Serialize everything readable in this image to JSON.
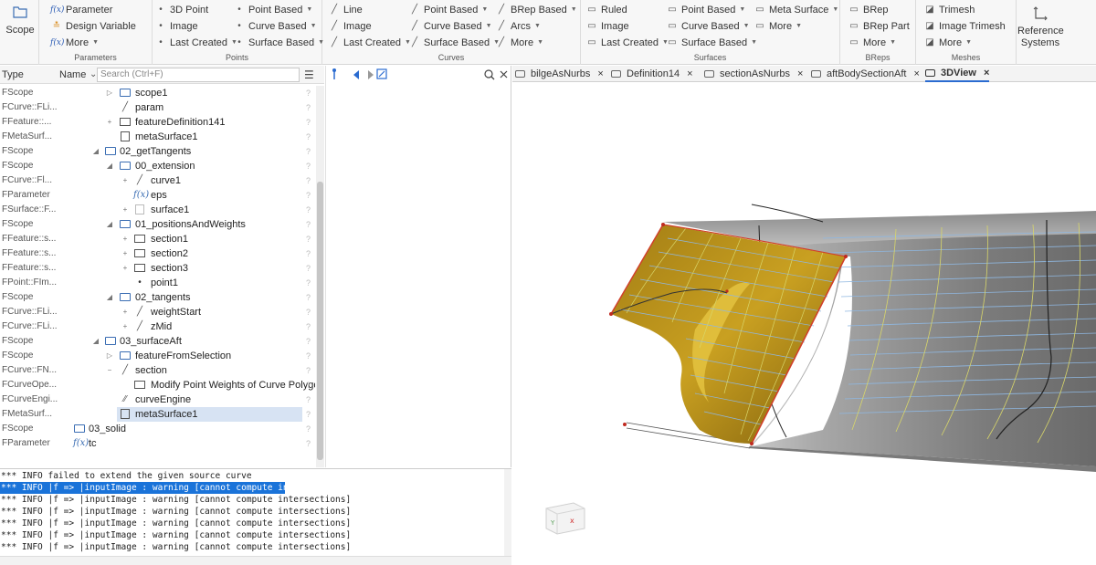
{
  "ribbon": {
    "scope_label": "Scope",
    "parameters": {
      "label": "Parameters",
      "items": [
        "Parameter",
        "Design Variable",
        "More"
      ]
    },
    "points": {
      "label": "Points",
      "col1": [
        "3D Point",
        "Image",
        "Last Created"
      ],
      "col2": [
        "Point Based",
        "Curve Based",
        "Surface Based"
      ]
    },
    "curves": {
      "label": "Curves",
      "col1": [
        "Line",
        "Image",
        "Last Created"
      ],
      "col2": [
        "Point Based",
        "Curve Based",
        "Surface Based"
      ],
      "col3": [
        "BRep Based",
        "Arcs",
        "More"
      ]
    },
    "surfaces": {
      "label": "Surfaces",
      "col1": [
        "Ruled",
        "Image",
        "Last Created"
      ],
      "col2": [
        "Point Based",
        "Curve Based",
        "Surface Based"
      ],
      "col3": [
        "Meta Surface",
        "More"
      ]
    },
    "breps": {
      "label": "BReps",
      "items": [
        "BRep",
        "BRep Part",
        "More"
      ]
    },
    "meshes": {
      "label": "Meshes",
      "items": [
        "Trimesh",
        "Image Trimesh",
        "More"
      ]
    },
    "reference_label_1": "Reference",
    "reference_label_2": "Systems"
  },
  "tree": {
    "col_type": "Type",
    "col_name": "Name",
    "search_placeholder": "Search (Ctrl+F)",
    "rows": [
      {
        "type": "FScope",
        "name": "scope1"
      },
      {
        "type": "FCurve::FLi...",
        "name": "param"
      },
      {
        "type": "FFeature::...",
        "name": "featureDefinition141"
      },
      {
        "type": "FMetaSurf...",
        "name": "metaSurface1"
      },
      {
        "type": "FScope",
        "name": "02_getTangents"
      },
      {
        "type": "FScope",
        "name": "00_extension"
      },
      {
        "type": "FCurve::Fl...",
        "name": "curve1"
      },
      {
        "type": "FParameter",
        "name": "eps"
      },
      {
        "type": "FSurface::F...",
        "name": "surface1"
      },
      {
        "type": "FScope",
        "name": "01_positionsAndWeights"
      },
      {
        "type": "FFeature::s...",
        "name": "section1"
      },
      {
        "type": "FFeature::s...",
        "name": "section2"
      },
      {
        "type": "FFeature::s...",
        "name": "section3"
      },
      {
        "type": "FPoint::FIm...",
        "name": "point1"
      },
      {
        "type": "FScope",
        "name": "02_tangents"
      },
      {
        "type": "FCurve::FLi...",
        "name": "weightStart"
      },
      {
        "type": "FCurve::FLi...",
        "name": "zMid"
      },
      {
        "type": "FScope",
        "name": "03_surfaceAft"
      },
      {
        "type": "FScope",
        "name": "featureFromSelection"
      },
      {
        "type": "FCurve::FN...",
        "name": "section"
      },
      {
        "type": "FCurveOpe...",
        "name": "Modify Point Weights of Curve Polygon"
      },
      {
        "type": "FCurveEngi...",
        "name": "curveEngine"
      },
      {
        "type": "FMetaSurf...",
        "name": "metaSurface1"
      },
      {
        "type": "FScope",
        "name": "03_solid"
      },
      {
        "type": "FParameter",
        "name": "tc"
      }
    ]
  },
  "log": {
    "lines": [
      "*** INFO failed to extend the given source curve",
      "*** INFO |f => |inputImage : warning [cannot compute intersections]",
      "*** INFO |f => |inputImage : warning [cannot compute intersections]",
      "*** INFO |f => |inputImage : warning [cannot compute intersections]",
      "*** INFO |f => |inputImage : warning [cannot compute intersections]",
      "*** INFO |f => |inputImage : warning [cannot compute intersections]",
      "*** INFO |f => |inputImage : warning [cannot compute intersections]"
    ]
  },
  "tabs": [
    "bilgeAsNurbs",
    "Definition14",
    "sectionAsNurbs",
    "aftBodySectionAft",
    "3DView"
  ],
  "tab_close": "×",
  "colors": {
    "accent": "#2a6bd0",
    "selection": "#d7e3f3",
    "log_highlight": "#1a73d9",
    "surface_gold": "#c89a18",
    "hull_grey": "#8a8a8a"
  }
}
